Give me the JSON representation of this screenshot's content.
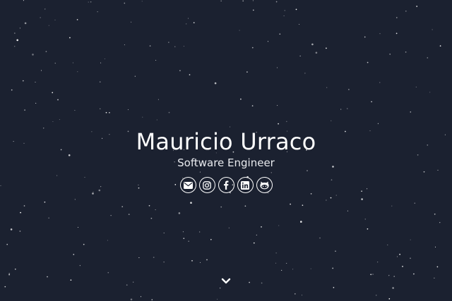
{
  "hero": {
    "name": "Mauricio Urraco",
    "subtitle": "Software Engineer"
  },
  "social_links": [
    {
      "icon": "envelope-icon"
    },
    {
      "icon": "instagram-icon"
    },
    {
      "icon": "facebook-icon"
    },
    {
      "icon": "linkedin-icon"
    },
    {
      "icon": "github-icon"
    }
  ],
  "scroll": {
    "icon": "chevron-down-icon"
  },
  "colors": {
    "background": "#1b2130",
    "text": "#ffffff",
    "star": "#ffffff"
  }
}
